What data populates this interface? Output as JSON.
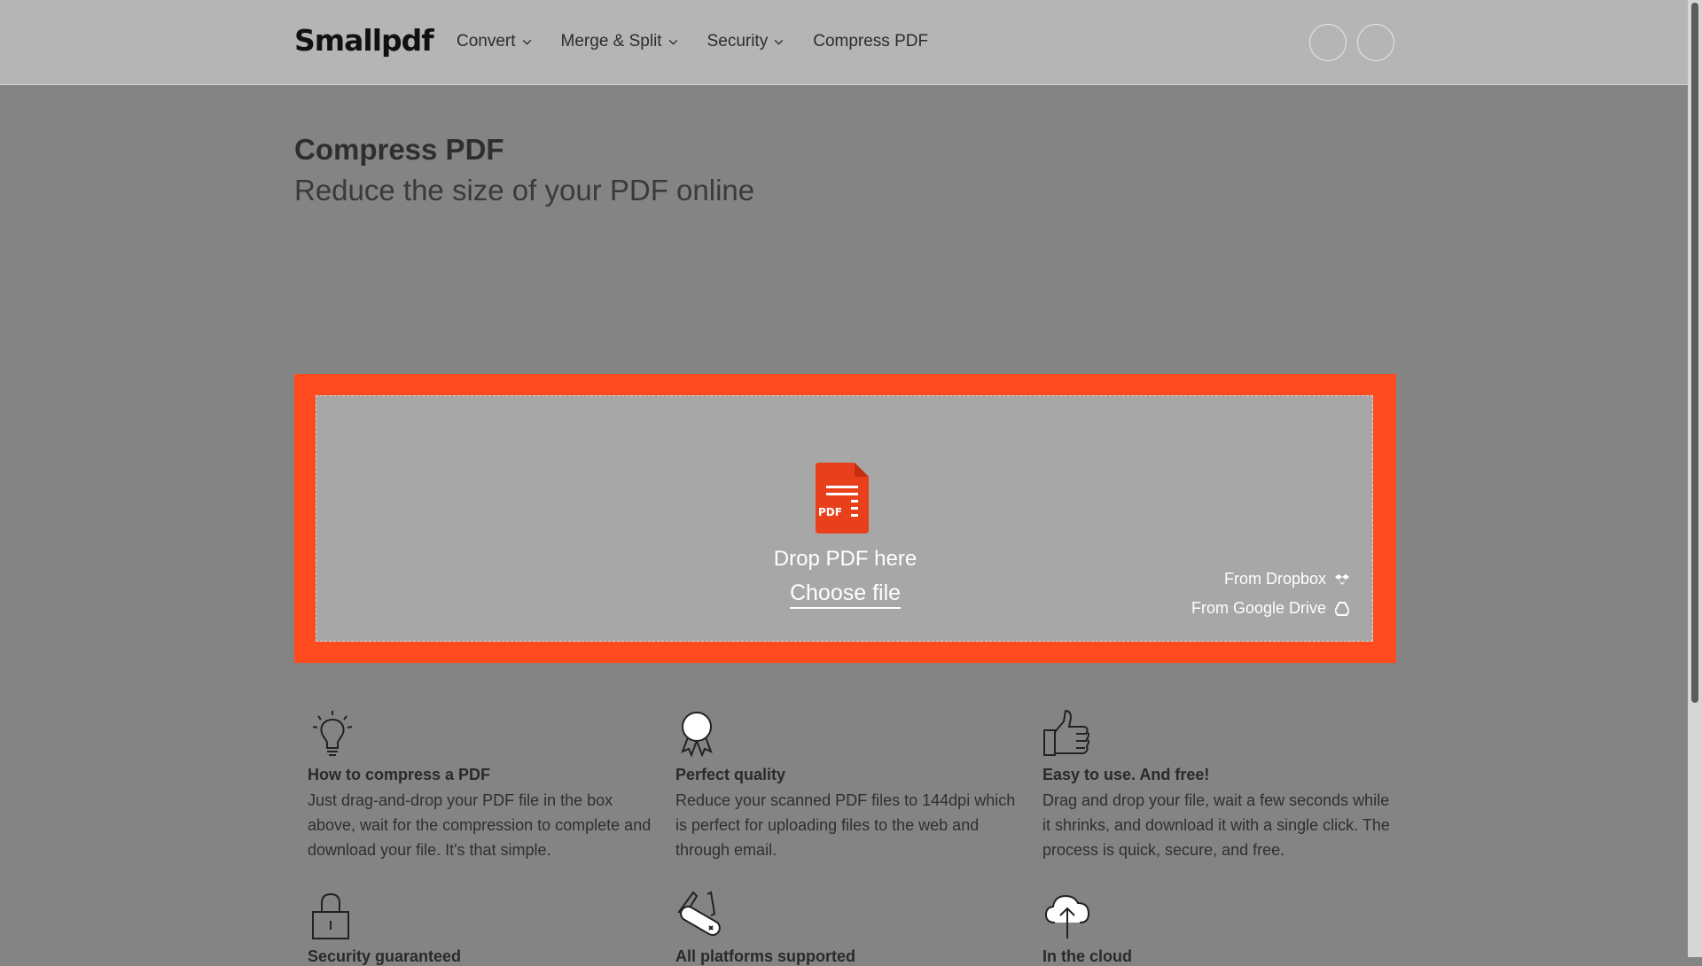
{
  "header": {
    "logo": "Smallpdf",
    "nav": [
      {
        "label": "Convert",
        "has_dropdown": true
      },
      {
        "label": "Merge & Split",
        "has_dropdown": true
      },
      {
        "label": "Security",
        "has_dropdown": true
      },
      {
        "label": "Compress PDF",
        "has_dropdown": false
      }
    ]
  },
  "main": {
    "title": "Compress PDF",
    "subtitle": "Reduce the size of your PDF online"
  },
  "dropzone": {
    "icon_label": "PDF",
    "drop_text": "Drop PDF here",
    "choose_file": "Choose file",
    "from_dropbox": "From Dropbox",
    "from_google_drive": "From Google Drive",
    "accent_color": "#ff4b1f"
  },
  "features": [
    {
      "icon": "lightbulb-icon",
      "title": "How to compress a PDF",
      "body": "Just drag-and-drop your PDF file in the box above, wait for the compression to complete and download your file. It's that simple."
    },
    {
      "icon": "award-ribbon-icon",
      "title": "Perfect quality",
      "body": "Reduce your scanned PDF files to 144dpi which is perfect for uploading files to the web and through email."
    },
    {
      "icon": "thumbs-up-icon",
      "title": "Easy to use. And free!",
      "body": "Drag and drop your file, wait a few seconds while it shrinks, and download it with a single click. The process is quick, secure, and free."
    },
    {
      "icon": "padlock-icon",
      "title": "Security guaranteed",
      "body": ""
    },
    {
      "icon": "pocket-knife-icon",
      "title": "All platforms supported",
      "body": ""
    },
    {
      "icon": "cloud-upload-icon",
      "title": "In the cloud",
      "body": ""
    }
  ]
}
